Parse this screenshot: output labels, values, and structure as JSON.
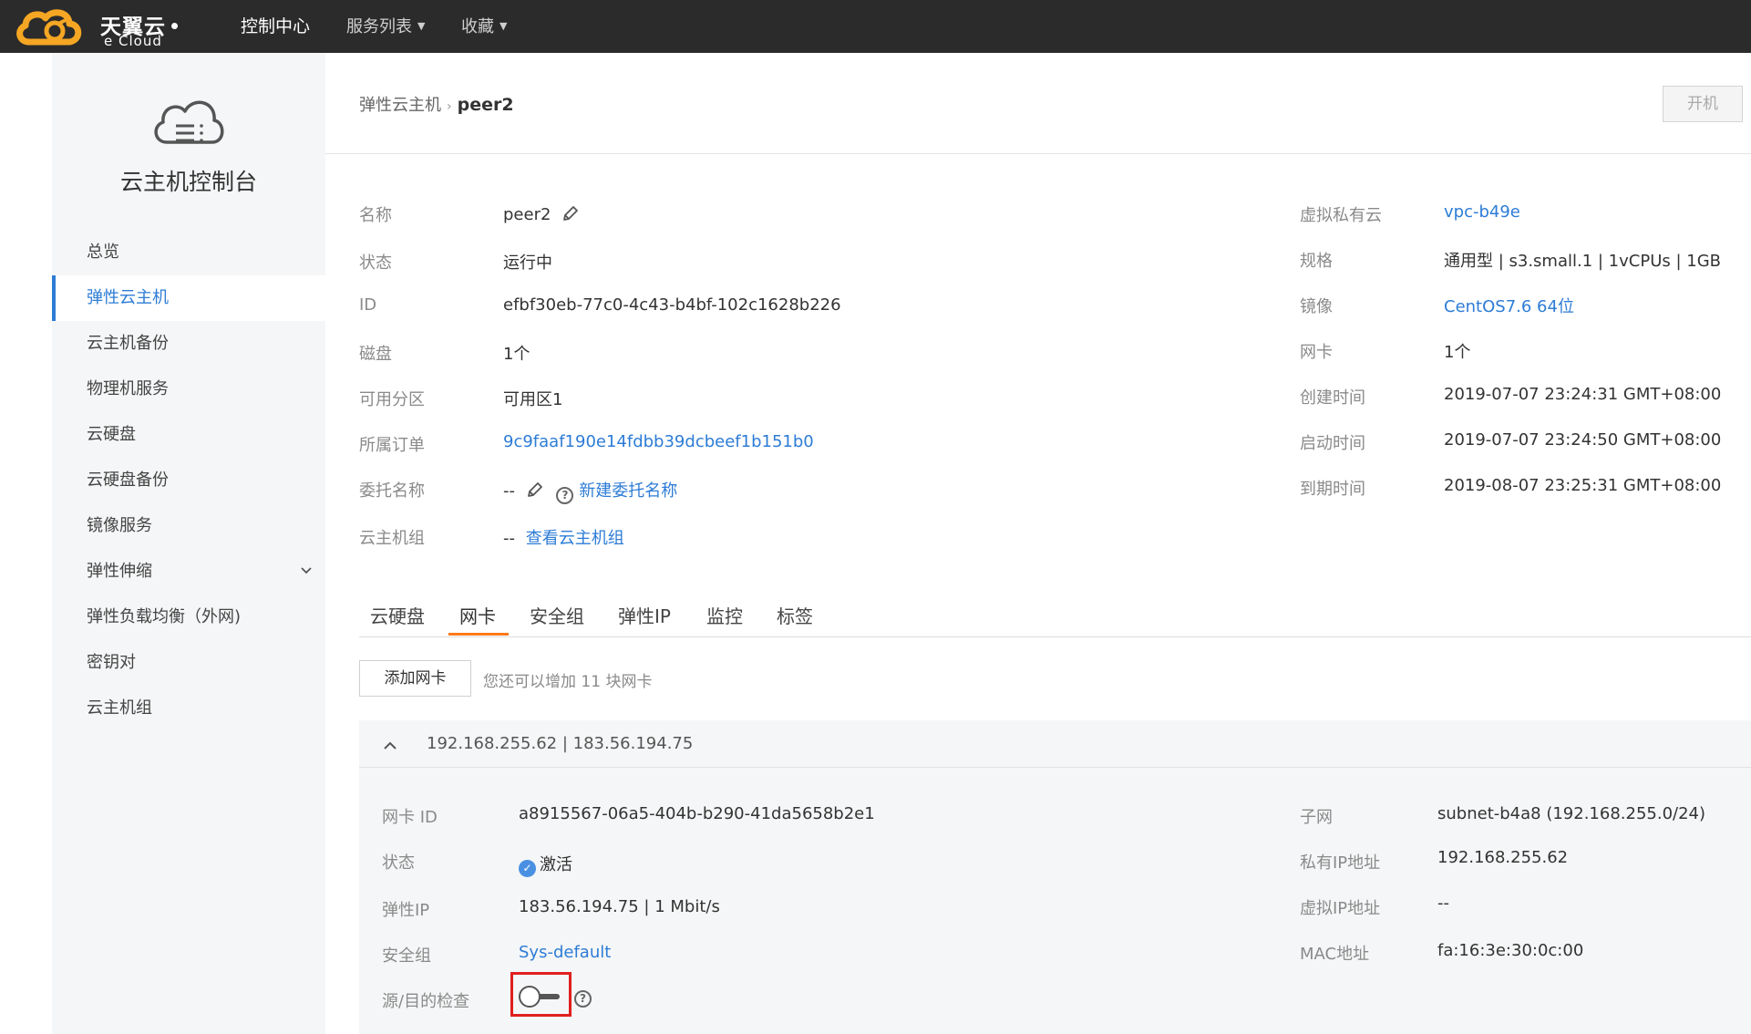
{
  "topbar": {
    "logo_cn": "天翼云",
    "logo_en": "e Cloud",
    "nav": {
      "console": "控制中心",
      "services": "服务列表",
      "favorites": "收藏"
    }
  },
  "sidebar": {
    "title": "云主机控制台",
    "items": [
      {
        "label": "总览"
      },
      {
        "label": "弹性云主机"
      },
      {
        "label": "云主机备份"
      },
      {
        "label": "物理机服务"
      },
      {
        "label": "云硬盘"
      },
      {
        "label": "云硬盘备份"
      },
      {
        "label": "镜像服务"
      },
      {
        "label": "弹性伸缩"
      },
      {
        "label": "弹性负载均衡（外网)"
      },
      {
        "label": "密钥对"
      },
      {
        "label": "云主机组"
      }
    ]
  },
  "header": {
    "breadcrumb_parent": "弹性云主机",
    "breadcrumb_current": "peer2",
    "power_button": "开机"
  },
  "details_left": {
    "name_label": "名称",
    "name_value": "peer2",
    "status_label": "状态",
    "status_value": "运行中",
    "id_label": "ID",
    "id_value": "efbf30eb-77c0-4c43-b4bf-102c1628b226",
    "disk_label": "磁盘",
    "disk_value": "1个",
    "az_label": "可用分区",
    "az_value": "可用区1",
    "order_label": "所属订单",
    "order_value": "9c9faaf190e14fdbb39dcbeef1b151b0",
    "delegate_label": "委托名称",
    "delegate_value": "--",
    "delegate_link": "新建委托名称",
    "group_label": "云主机组",
    "group_value": "--",
    "group_link": "查看云主机组"
  },
  "details_right": {
    "vpc_label": "虚拟私有云",
    "vpc_value": "vpc-b49e",
    "spec_label": "规格",
    "spec_value": "通用型 | s3.small.1 | 1vCPUs | 1GB",
    "image_label": "镜像",
    "image_value": "CentOS7.6 64位",
    "nic_label": "网卡",
    "nic_value": "1个",
    "created_label": "创建时间",
    "created_value": "2019-07-07 23:24:31 GMT+08:00",
    "started_label": "启动时间",
    "started_value": "2019-07-07 23:24:50 GMT+08:00",
    "expire_label": "到期时间",
    "expire_value": "2019-08-07 23:25:31 GMT+08:00"
  },
  "tabs": [
    {
      "label": "云硬盘"
    },
    {
      "label": "网卡"
    },
    {
      "label": "安全组"
    },
    {
      "label": "弹性IP"
    },
    {
      "label": "监控"
    },
    {
      "label": "标签"
    }
  ],
  "active_tab": "网卡",
  "nic_section": {
    "add_button": "添加网卡",
    "add_tip": "您还可以增加 11 块网卡",
    "panel_title": "192.168.255.62 | 183.56.194.75",
    "id_label": "网卡 ID",
    "id_value": "a8915567-06a5-404b-b290-41da5658b2e1",
    "status_label": "状态",
    "status_value": "激活",
    "eip_label": "弹性IP",
    "eip_value": "183.56.194.75 | 1 Mbit/s",
    "sg_label": "安全组",
    "sg_value": "Sys-default",
    "check_label": "源/目的检查",
    "check_enabled": false,
    "subnet_label": "子网",
    "subnet_value": "subnet-b4a8 (192.168.255.0/24)",
    "private_ip_label": "私有IP地址",
    "private_ip_value": "192.168.255.62",
    "virtual_ip_label": "虚拟IP地址",
    "virtual_ip_value": "--",
    "mac_label": "MAC地址",
    "mac_value": "fa:16:3e:30:0c:00"
  },
  "colors": {
    "topbar": "#2b2b2b",
    "link": "#2d7cd6",
    "tab_active_underline": "#ff7a1a",
    "highlight_box": "#e0201e",
    "logo_orange": "#f5a623"
  }
}
